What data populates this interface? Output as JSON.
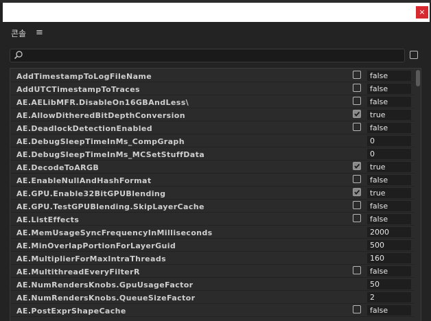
{
  "window": {
    "close_label": "×"
  },
  "panel": {
    "title": "콘솔",
    "menu_icon": "hamburger-menu-icon"
  },
  "search": {
    "placeholder": "",
    "value": ""
  },
  "colors": {
    "background": "#232323",
    "list_background": "#2b2b2b",
    "close_button": "#d7282f",
    "text": "#cfcfcf"
  },
  "rows": [
    {
      "name": "AddTimestampToLogFileName",
      "type": "bool",
      "checked": false,
      "value": "false"
    },
    {
      "name": "AddUTCTimestampToTraces",
      "type": "bool",
      "checked": false,
      "value": "false"
    },
    {
      "name": "AE.AELibMFR.DisableOn16GBAndLess\\",
      "type": "bool",
      "checked": false,
      "value": "false"
    },
    {
      "name": "AE.AllowDitheredBitDepthConversion",
      "type": "bool",
      "checked": true,
      "value": "true"
    },
    {
      "name": "AE.DeadlockDetectionEnabled",
      "type": "bool",
      "checked": false,
      "value": "false"
    },
    {
      "name": "AE.DebugSleepTimeInMs_CompGraph",
      "type": "num",
      "checked": false,
      "value": "0"
    },
    {
      "name": "AE.DebugSleepTimeInMs_MCSetStuffData",
      "type": "num",
      "checked": false,
      "value": "0"
    },
    {
      "name": "AE.DecodeToARGB",
      "type": "bool",
      "checked": true,
      "value": "true"
    },
    {
      "name": "AE.EnableNullAndHashFormat",
      "type": "bool",
      "checked": false,
      "value": "false"
    },
    {
      "name": "AE.GPU.Enable32BitGPUBlending",
      "type": "bool",
      "checked": true,
      "value": "true"
    },
    {
      "name": "AE.GPU.TestGPUBlending.SkipLayerCache",
      "type": "bool",
      "checked": false,
      "value": "false"
    },
    {
      "name": "AE.ListEffects",
      "type": "bool",
      "checked": false,
      "value": "false"
    },
    {
      "name": "AE.MemUsageSyncFrequencyInMilliseconds",
      "type": "num",
      "checked": false,
      "value": "2000"
    },
    {
      "name": "AE.MinOverlapPortionForLayerGuid",
      "type": "num",
      "checked": false,
      "value": "500"
    },
    {
      "name": "AE.MultiplierForMaxIntraThreads",
      "type": "num",
      "checked": false,
      "value": "160"
    },
    {
      "name": "AE.MultithreadEveryFilterR",
      "type": "bool",
      "checked": false,
      "value": "false"
    },
    {
      "name": "AE.NumRendersKnobs.GpuUsageFactor",
      "type": "num",
      "checked": false,
      "value": "50"
    },
    {
      "name": "AE.NumRendersKnobs.QueueSizeFactor",
      "type": "num",
      "checked": false,
      "value": "2"
    },
    {
      "name": "AE.PostExprShapeCache",
      "type": "bool",
      "checked": false,
      "value": "false"
    }
  ]
}
